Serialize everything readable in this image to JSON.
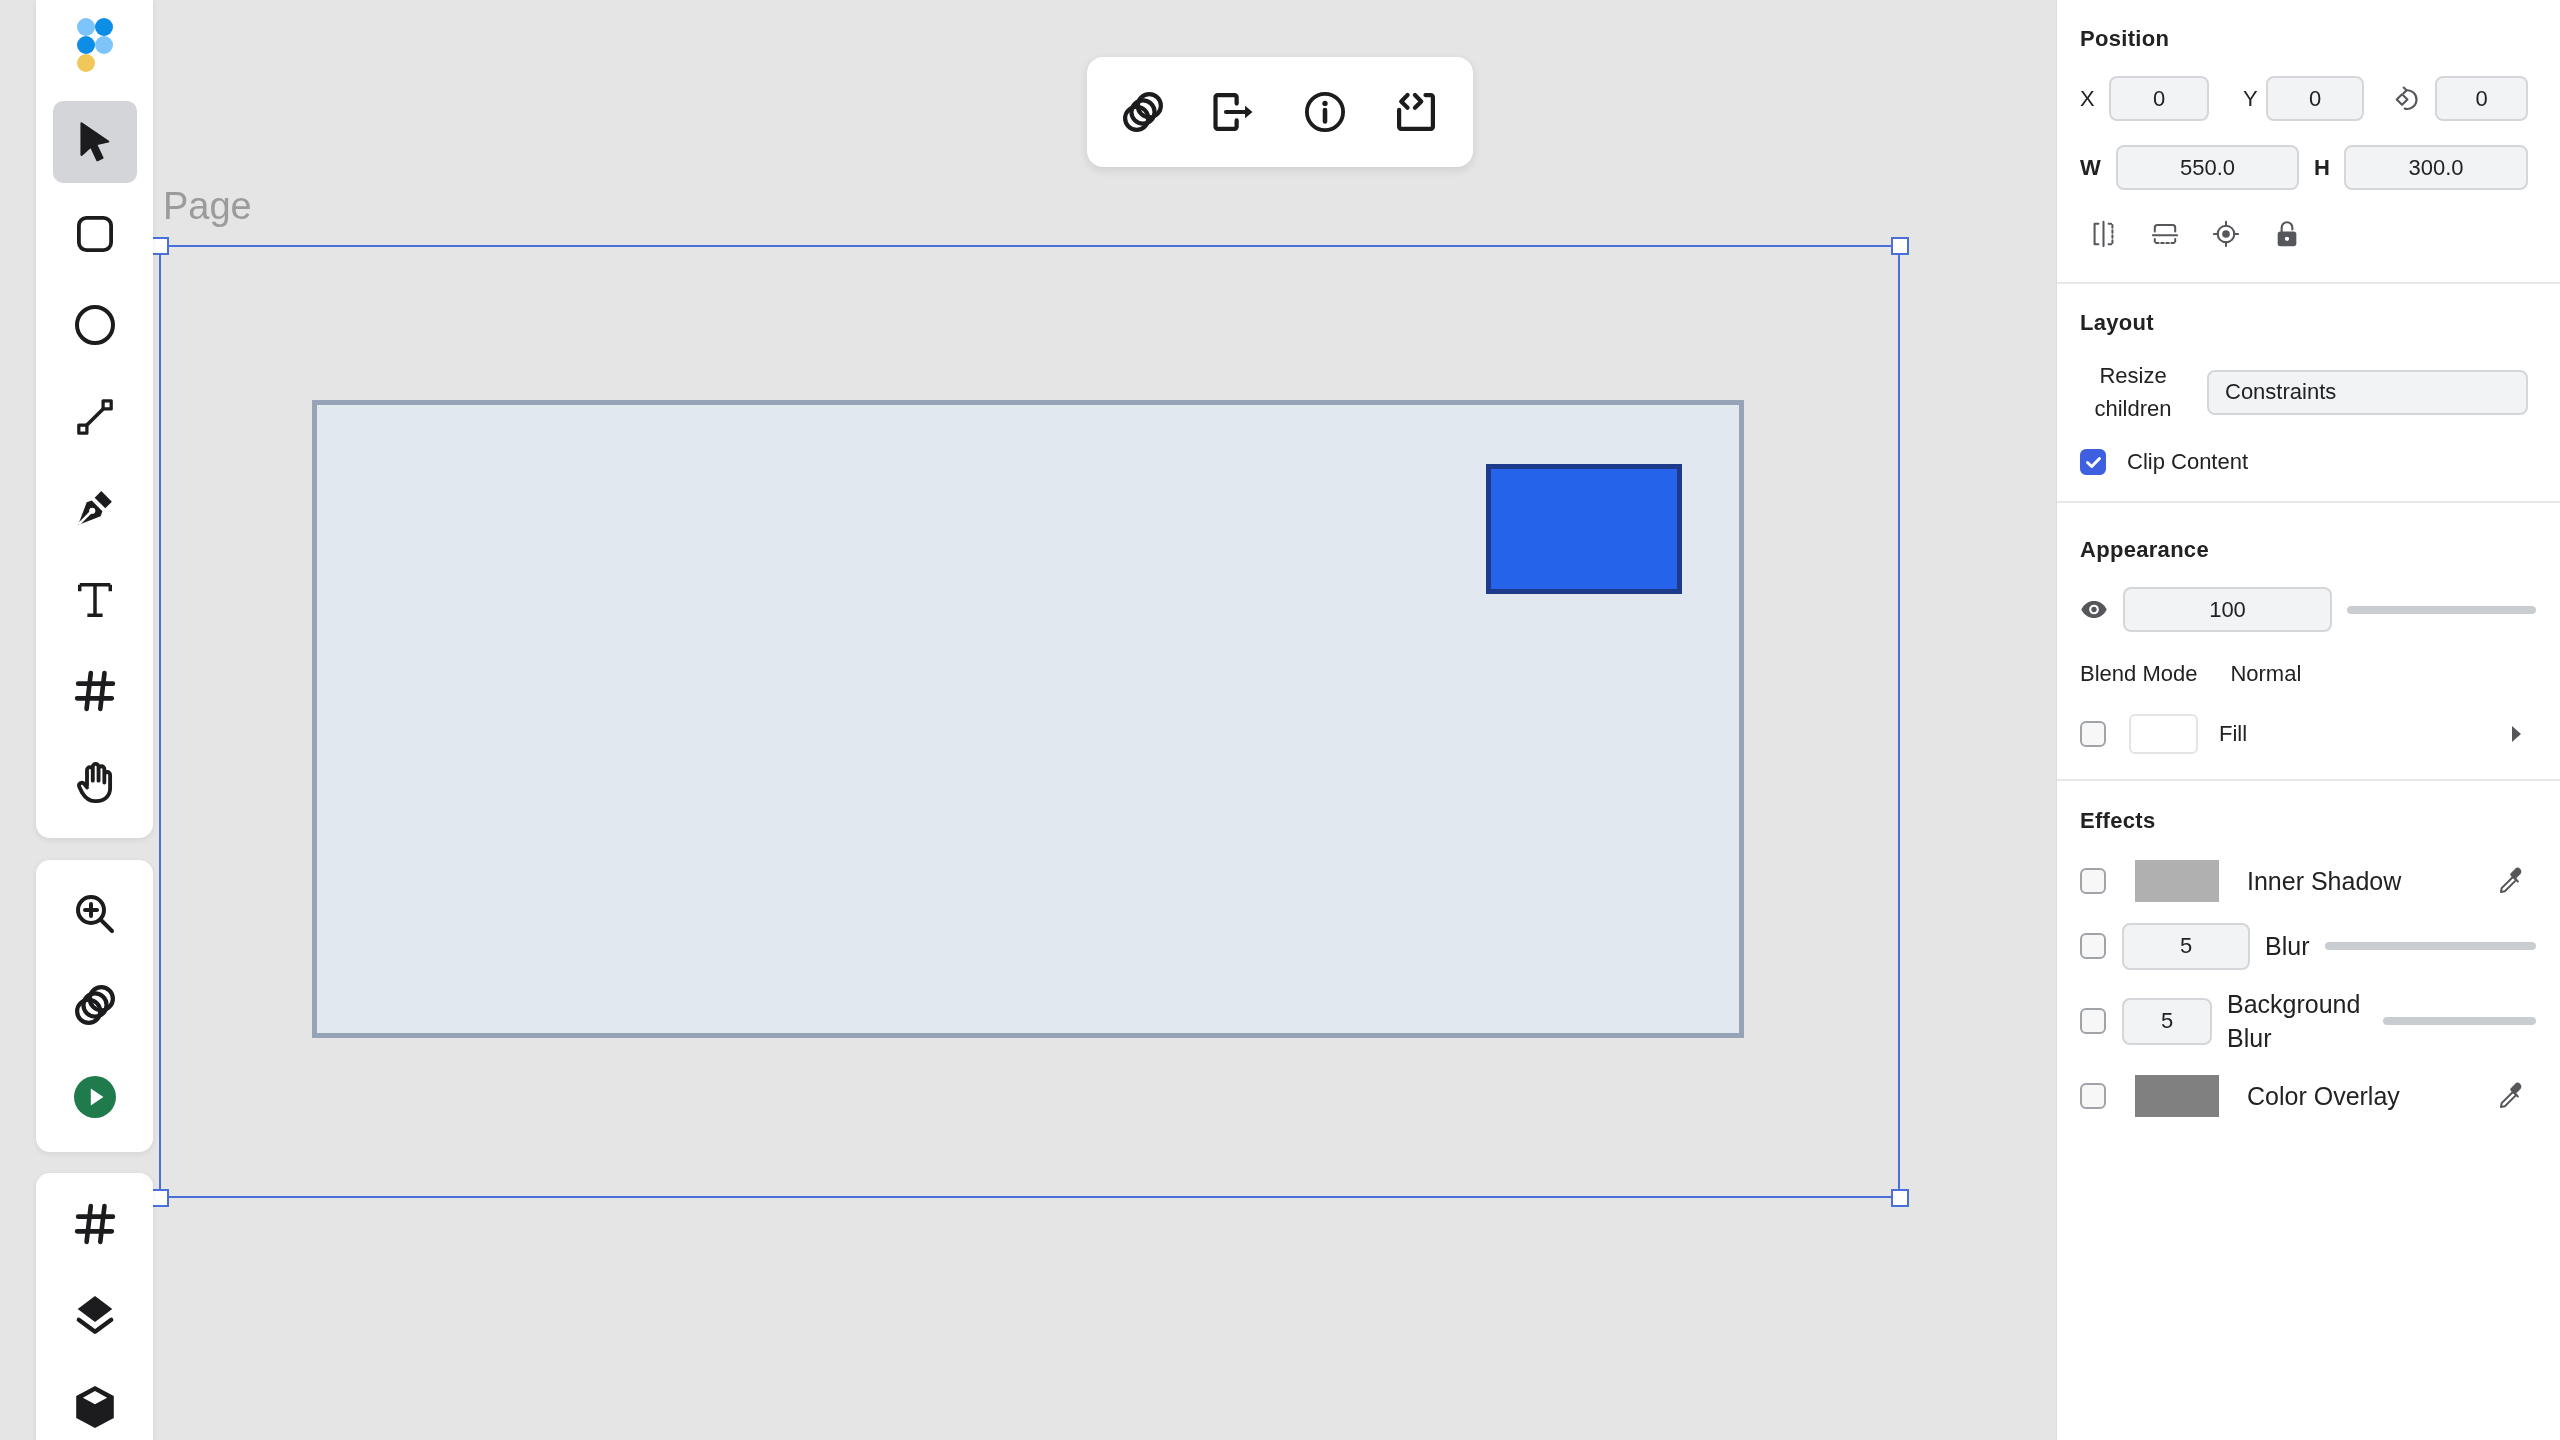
{
  "tools": [
    {
      "selected": true
    },
    {
      "selected": false
    },
    {
      "selected": false
    },
    {
      "selected": false
    },
    {
      "selected": false
    },
    {
      "selected": false
    },
    {
      "selected": false
    },
    {
      "selected": false
    }
  ],
  "canvas": {
    "frame_label": "Page"
  },
  "properties": {
    "position": {
      "title": "Position",
      "x": {
        "label": "X",
        "value": "0"
      },
      "y": {
        "label": "Y",
        "value": "0"
      },
      "rotation": {
        "value": "0"
      },
      "width": {
        "label": "W",
        "value": "550.0"
      },
      "height": {
        "label": "H",
        "value": "300.0"
      }
    },
    "layout": {
      "title": "Layout",
      "resize": {
        "label": "Resize children",
        "value": "Constraints"
      },
      "clip_content": {
        "label": "Clip Content",
        "checked": true
      }
    },
    "appearance": {
      "title": "Appearance",
      "opacity": {
        "value": "100",
        "level": 1
      },
      "blend_mode": {
        "label": "Blend Mode",
        "value": "Normal"
      },
      "fill": {
        "label": "Fill",
        "checked": false
      }
    },
    "effects": {
      "title": "Effects",
      "items": [
        {
          "kind": "swatch",
          "label": "Inner Shadow",
          "checked": false,
          "color": "#b0b0b0"
        },
        {
          "kind": "slider",
          "label": "Blur",
          "value": "5",
          "checked": false,
          "level": 1
        },
        {
          "kind": "slider",
          "label": "Background Blur",
          "value": "5",
          "checked": false,
          "level": 1
        },
        {
          "kind": "swatch",
          "label": "Color Overlay",
          "checked": false,
          "color": "#808080"
        }
      ]
    }
  }
}
